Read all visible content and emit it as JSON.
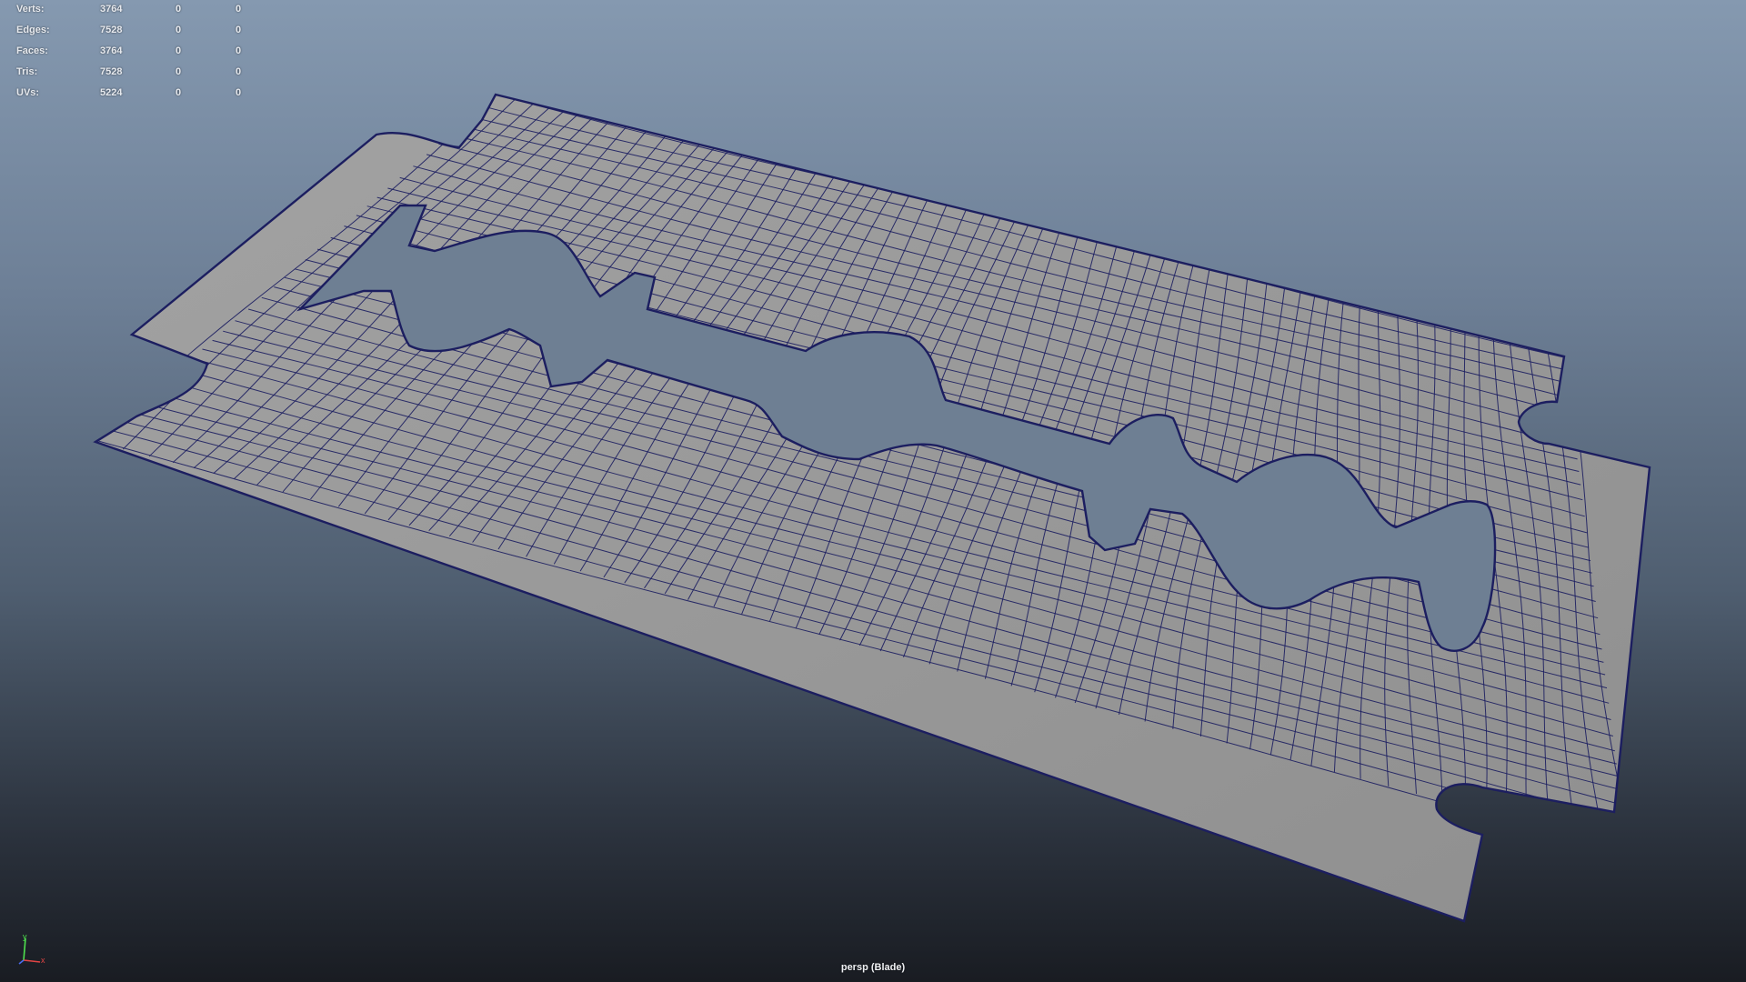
{
  "viewport": {
    "camera_label": "persp (Blade)",
    "background_top": "#8599b0",
    "background_bottom": "#191c22"
  },
  "heads_up_display": {
    "poly_count": [
      {
        "label": "Verts:",
        "total": "3764",
        "selected": "0",
        "uv_selected": "0"
      },
      {
        "label": "Edges:",
        "total": "7528",
        "selected": "0",
        "uv_selected": "0"
      },
      {
        "label": "Faces:",
        "total": "3764",
        "selected": "0",
        "uv_selected": "0"
      },
      {
        "label": "Tris:",
        "total": "7528",
        "selected": "0",
        "uv_selected": "0"
      },
      {
        "label": "UVs:",
        "total": "5224",
        "selected": "0",
        "uv_selected": "0"
      }
    ]
  },
  "axis_gizmo": {
    "y_label": "y",
    "x_label": "x",
    "y_color": "#4ee04e",
    "x_color": "#e04444",
    "z_color": "#4a6cf0"
  },
  "mesh": {
    "name": "Blade",
    "face_color": "#979797",
    "wire_color": "#1c1e60"
  }
}
